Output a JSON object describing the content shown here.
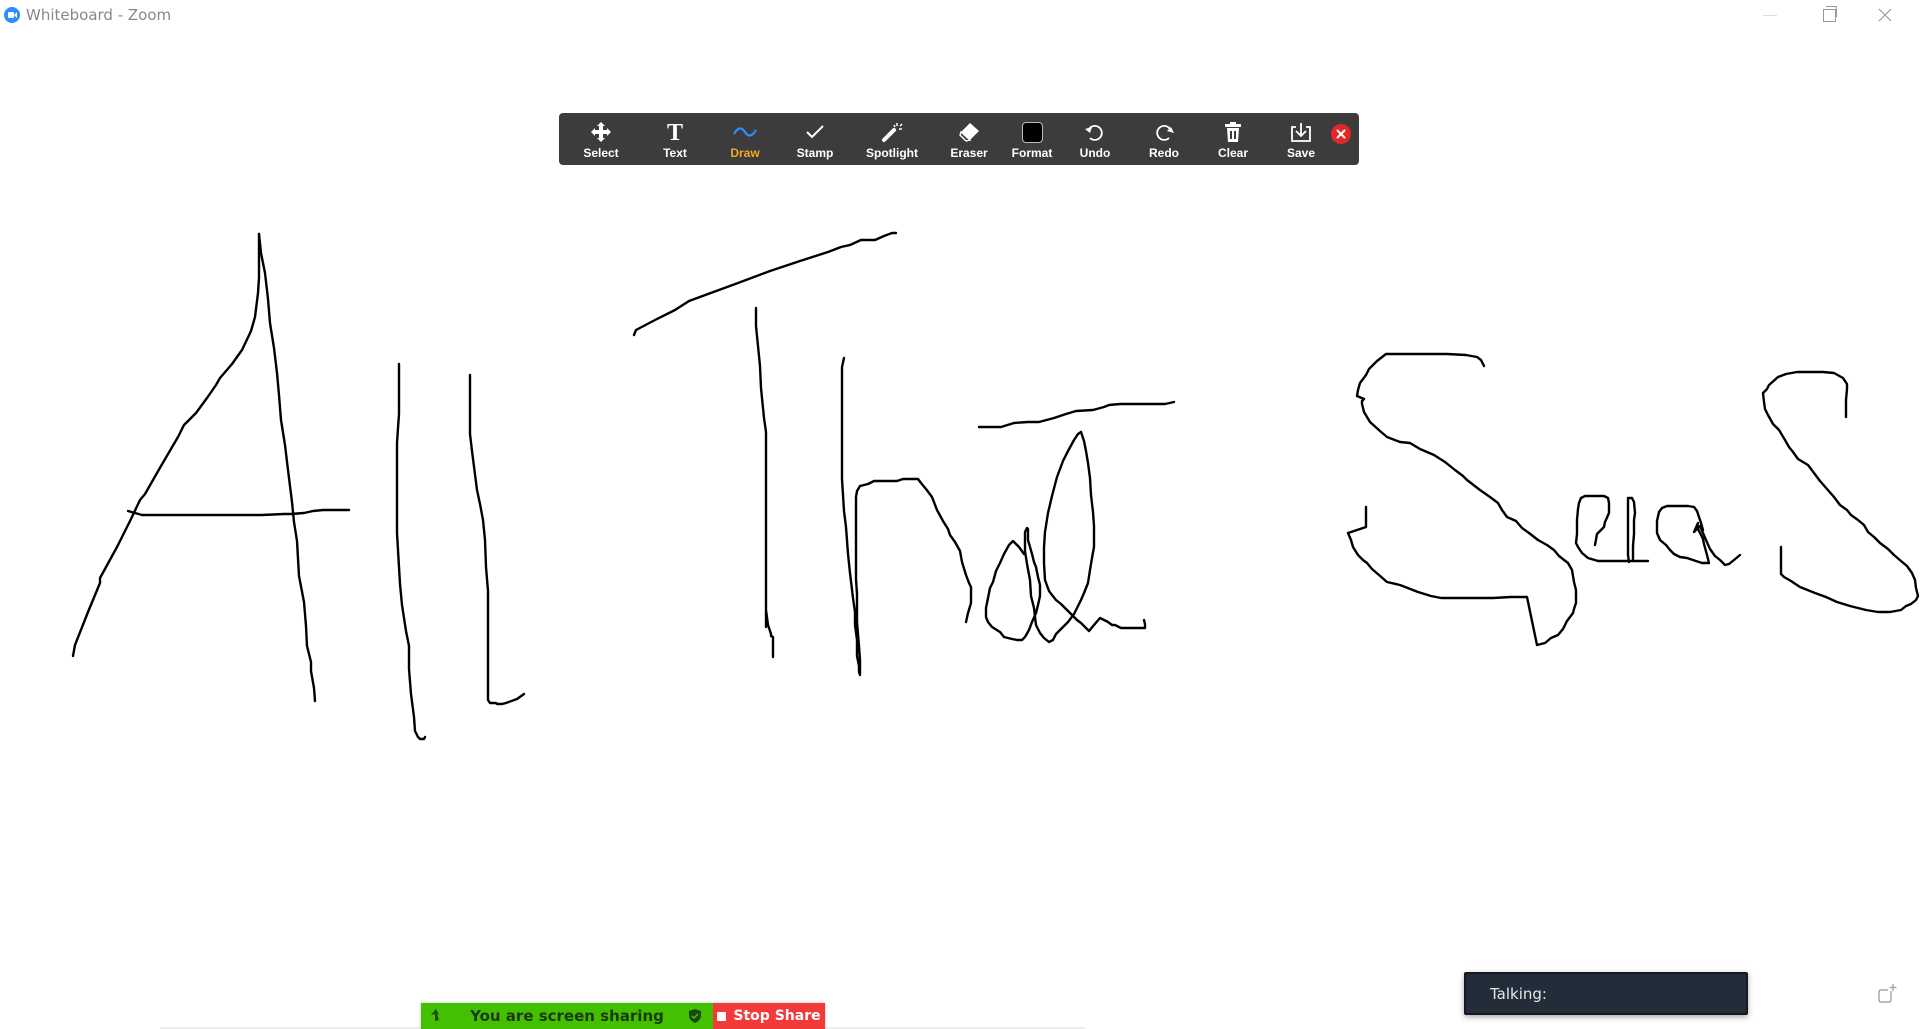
{
  "window": {
    "title": "Whiteboard - Zoom",
    "controls": [
      "minimize",
      "restore",
      "close"
    ]
  },
  "toolbar": {
    "items": [
      {
        "label": "Select",
        "icon": "move-arrows-icon",
        "active": false
      },
      {
        "label": "Text",
        "icon": "text-t-icon",
        "active": false
      },
      {
        "label": "Draw",
        "icon": "squiggle-icon",
        "active": true
      },
      {
        "label": "Stamp",
        "icon": "checkmark-icon",
        "active": false
      },
      {
        "label": "Spotlight",
        "icon": "magic-wand-icon",
        "active": false
      },
      {
        "label": "Eraser",
        "icon": "eraser-icon",
        "active": false
      },
      {
        "label": "Format",
        "icon": "color-swatch-icon",
        "active": false
      },
      {
        "label": "Undo",
        "icon": "undo-icon",
        "active": false
      },
      {
        "label": "Redo",
        "icon": "redo-icon",
        "active": false
      },
      {
        "label": "Clear",
        "icon": "trash-icon",
        "active": false
      },
      {
        "label": "Save",
        "icon": "download-icon",
        "active": false
      }
    ],
    "active_color": "#f5a623",
    "format_color": "#000000",
    "close_icon": "close-icon"
  },
  "whiteboard": {
    "handwritten_text": "All That SaaS",
    "ink_color": "#000000"
  },
  "share_bar": {
    "status": "You are screen sharing",
    "stop_label": "Stop Share",
    "status_color": "#45c000",
    "stop_color": "#f23a3a"
  },
  "talking": {
    "label": "Talking:"
  }
}
